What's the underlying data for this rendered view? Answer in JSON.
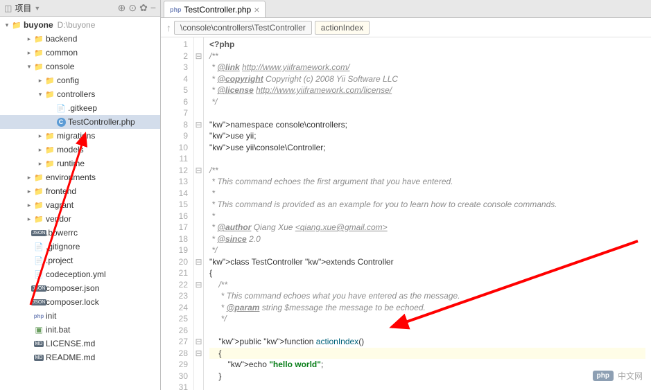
{
  "sidebar": {
    "title": "项目",
    "project": {
      "name": "buyone",
      "path": "D:\\buyone"
    },
    "tree": [
      {
        "label": "backend",
        "type": "folder",
        "level": 2,
        "arrow": "▸"
      },
      {
        "label": "common",
        "type": "folder",
        "level": 2,
        "arrow": "▸"
      },
      {
        "label": "console",
        "type": "folder",
        "level": 2,
        "arrow": "▾"
      },
      {
        "label": "config",
        "type": "folder",
        "level": 3,
        "arrow": "▸"
      },
      {
        "label": "controllers",
        "type": "folder",
        "level": 3,
        "arrow": "▾"
      },
      {
        "label": ".gitkeep",
        "type": "file",
        "level": 4,
        "icon": "txt"
      },
      {
        "label": "TestController.php",
        "type": "file",
        "level": 4,
        "icon": "class",
        "selected": true
      },
      {
        "label": "migrations",
        "type": "folder",
        "level": 3,
        "arrow": "▸"
      },
      {
        "label": "models",
        "type": "folder",
        "level": 3,
        "arrow": "▸"
      },
      {
        "label": "runtime",
        "type": "folder",
        "level": 3,
        "arrow": "▸"
      },
      {
        "label": "environments",
        "type": "folder",
        "level": 2,
        "arrow": "▸"
      },
      {
        "label": "frontend",
        "type": "folder",
        "level": 2,
        "arrow": "▸"
      },
      {
        "label": "vagrant",
        "type": "folder",
        "level": 2,
        "arrow": "▸"
      },
      {
        "label": "vendor",
        "type": "folder",
        "level": 2,
        "arrow": "▸"
      },
      {
        "label": ".bowerrc",
        "type": "file",
        "level": 2,
        "icon": "json"
      },
      {
        "label": ".gitignore",
        "type": "file",
        "level": 2,
        "icon": "txt"
      },
      {
        "label": ".project",
        "type": "file",
        "level": 2,
        "icon": "txt"
      },
      {
        "label": "codeception.yml",
        "type": "file",
        "level": 2,
        "icon": "txt"
      },
      {
        "label": "composer.json",
        "type": "file",
        "level": 2,
        "icon": "json"
      },
      {
        "label": "composer.lock",
        "type": "file",
        "level": 2,
        "icon": "json"
      },
      {
        "label": "init",
        "type": "file",
        "level": 2,
        "icon": "php"
      },
      {
        "label": "init.bat",
        "type": "file",
        "level": 2,
        "icon": "bat"
      },
      {
        "label": "LICENSE.md",
        "type": "file",
        "level": 2,
        "icon": "md"
      },
      {
        "label": "README.md",
        "type": "file",
        "level": 2,
        "icon": "md"
      }
    ]
  },
  "tabs": [
    {
      "label": "TestController.php",
      "icon": "php"
    }
  ],
  "breadcrumb": {
    "path": "\\console\\controllers\\TestController",
    "method": "actionIndex"
  },
  "editor": {
    "start_line": 1,
    "lines": [
      "<?php",
      "/**",
      " * @link http://www.yiiframework.com/",
      " * @copyright Copyright (c) 2008 Yii Software LLC",
      " * @license http://www.yiiframework.com/license/",
      " */",
      "",
      "namespace console\\controllers;",
      "use yii;",
      "use yii\\console\\Controller;",
      "",
      "/**",
      " * This command echoes the first argument that you have entered.",
      " *",
      " * This command is provided as an example for you to learn how to create console commands.",
      " *",
      " * @author Qiang Xue <qiang.xue@gmail.com>",
      " * @since 2.0",
      " */",
      "class TestController extends Controller",
      "{",
      "    /**",
      "     * This command echoes what you have entered as the message.",
      "     * @param string $message the message to be echoed.",
      "     */",
      "",
      "    public function actionIndex()",
      "    {",
      "        echo \"hello world\";",
      "    }",
      ""
    ]
  },
  "watermark": {
    "badge": "php",
    "text": "中文网"
  }
}
